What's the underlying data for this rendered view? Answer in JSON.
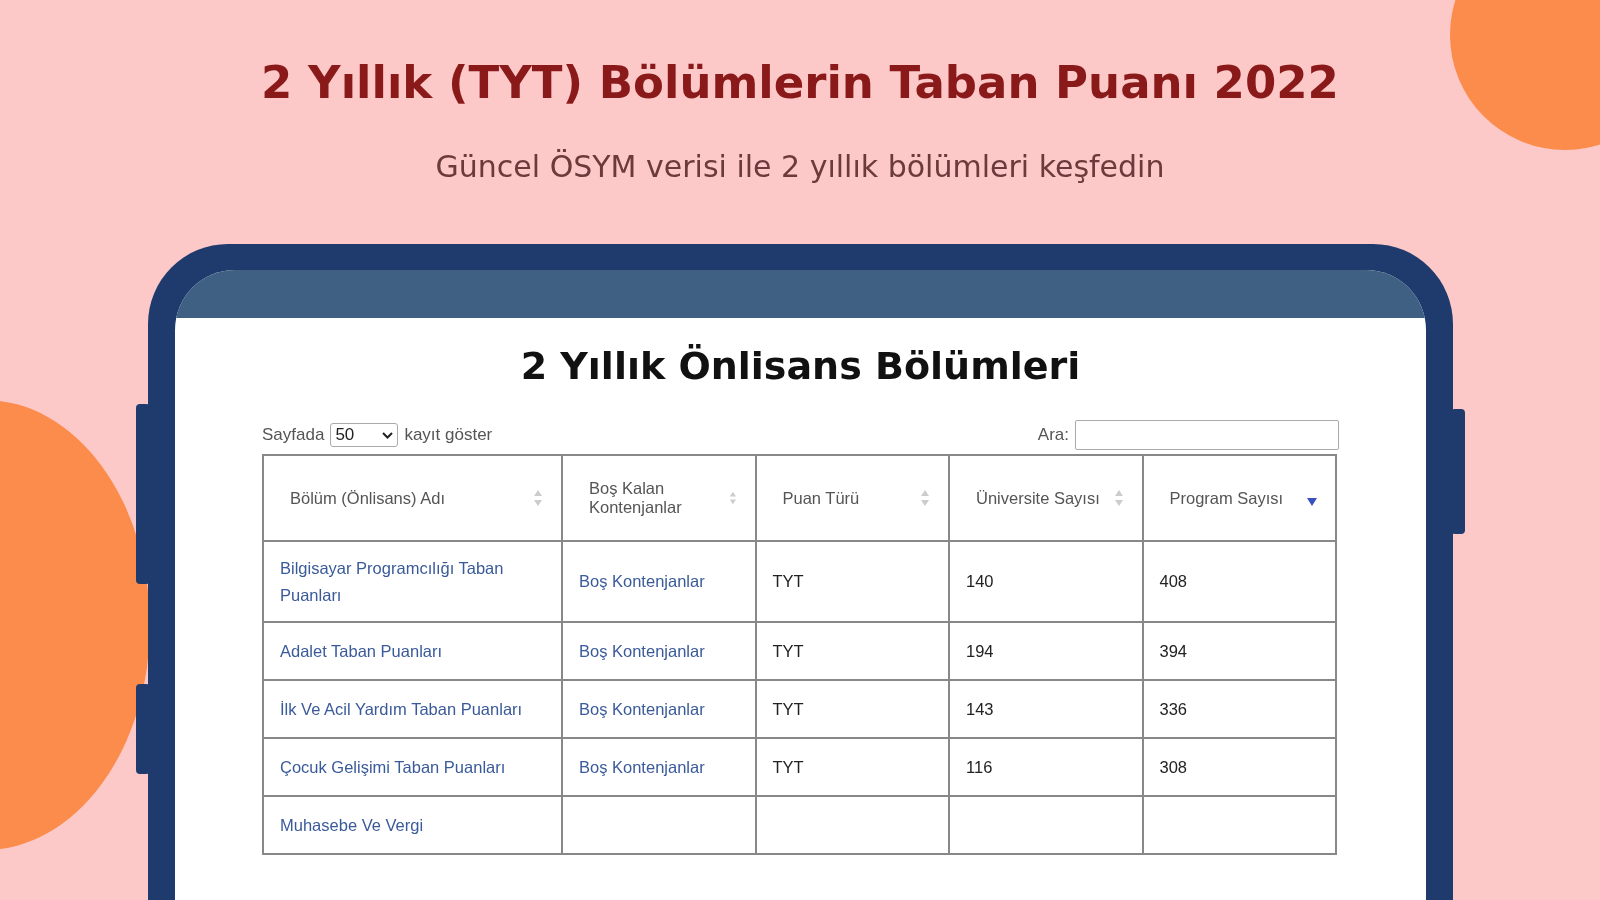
{
  "title": "2 Yıllık (TYT) Bölümlerin Taban Puanı 2022",
  "subtitle": "Güncel ÖSYM verisi ile 2 yıllık bölümleri keşfedin",
  "screen": {
    "heading": "2 Yıllık Önlisans Bölümleri",
    "page_size": {
      "label_before": "Sayfada",
      "value": "50",
      "label_after": "kayıt göster"
    },
    "search": {
      "label": "Ara:"
    },
    "table": {
      "columns": [
        {
          "label": "Bölüm (Önlisans) Adı",
          "sorted": false
        },
        {
          "label": "Boş Kalan Kontenjanlar",
          "sorted": false
        },
        {
          "label": "Puan Türü",
          "sorted": false
        },
        {
          "label": "Üniversite Sayısı",
          "sorted": false
        },
        {
          "label": "Program Sayısı",
          "sorted": true
        }
      ],
      "rows": [
        [
          "Bilgisayar Programcılığı Taban Puanları",
          "Boş Kontenjanlar",
          "TYT",
          "140",
          "408"
        ],
        [
          "Adalet Taban Puanları",
          "Boş Kontenjanlar",
          "TYT",
          "194",
          "394"
        ],
        [
          "İlk Ve Acil Yardım Taban Puanları",
          "Boş Kontenjanlar",
          "TYT",
          "143",
          "336"
        ],
        [
          "Çocuk Gelişimi Taban Puanları",
          "Boş Kontenjanlar",
          "TYT",
          "116",
          "308"
        ],
        [
          "Muhasebe Ve Vergi"
        ]
      ]
    }
  }
}
